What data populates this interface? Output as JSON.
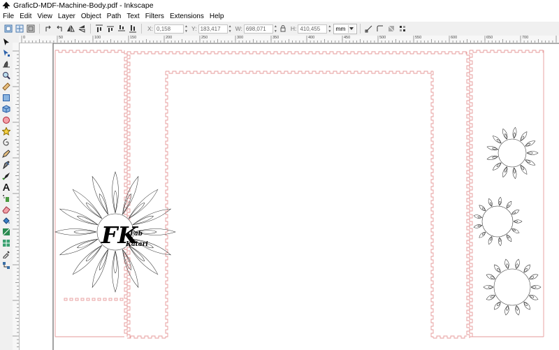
{
  "window": {
    "title": "GraficD-MDF-Machine-Body.pdf - Inkscape"
  },
  "menu": {
    "items": [
      "File",
      "Edit",
      "View",
      "Layer",
      "Object",
      "Path",
      "Text",
      "Filters",
      "Extensions",
      "Help"
    ]
  },
  "toolbar": {
    "x_label": "X:",
    "x_value": "0,158",
    "y_label": "Y:",
    "y_value": "183,417",
    "w_label": "W:",
    "w_value": "698,071",
    "h_label": "H:",
    "h_value": "410,455",
    "unit": "mm"
  },
  "ruler": {
    "labels": [
      "0",
      "50",
      "100",
      "150",
      "200",
      "250",
      "300",
      "350",
      "400",
      "450",
      "500",
      "550",
      "600",
      "650",
      "700"
    ]
  },
  "canvas": {
    "logo_monogram": "FK",
    "logo_line1": "Fab",
    "logo_line2": "Katari"
  },
  "colors": {
    "cut_line": "#e69a9a",
    "canvas_bg": "#ffffff",
    "ui_bg": "#f0f0f0"
  }
}
